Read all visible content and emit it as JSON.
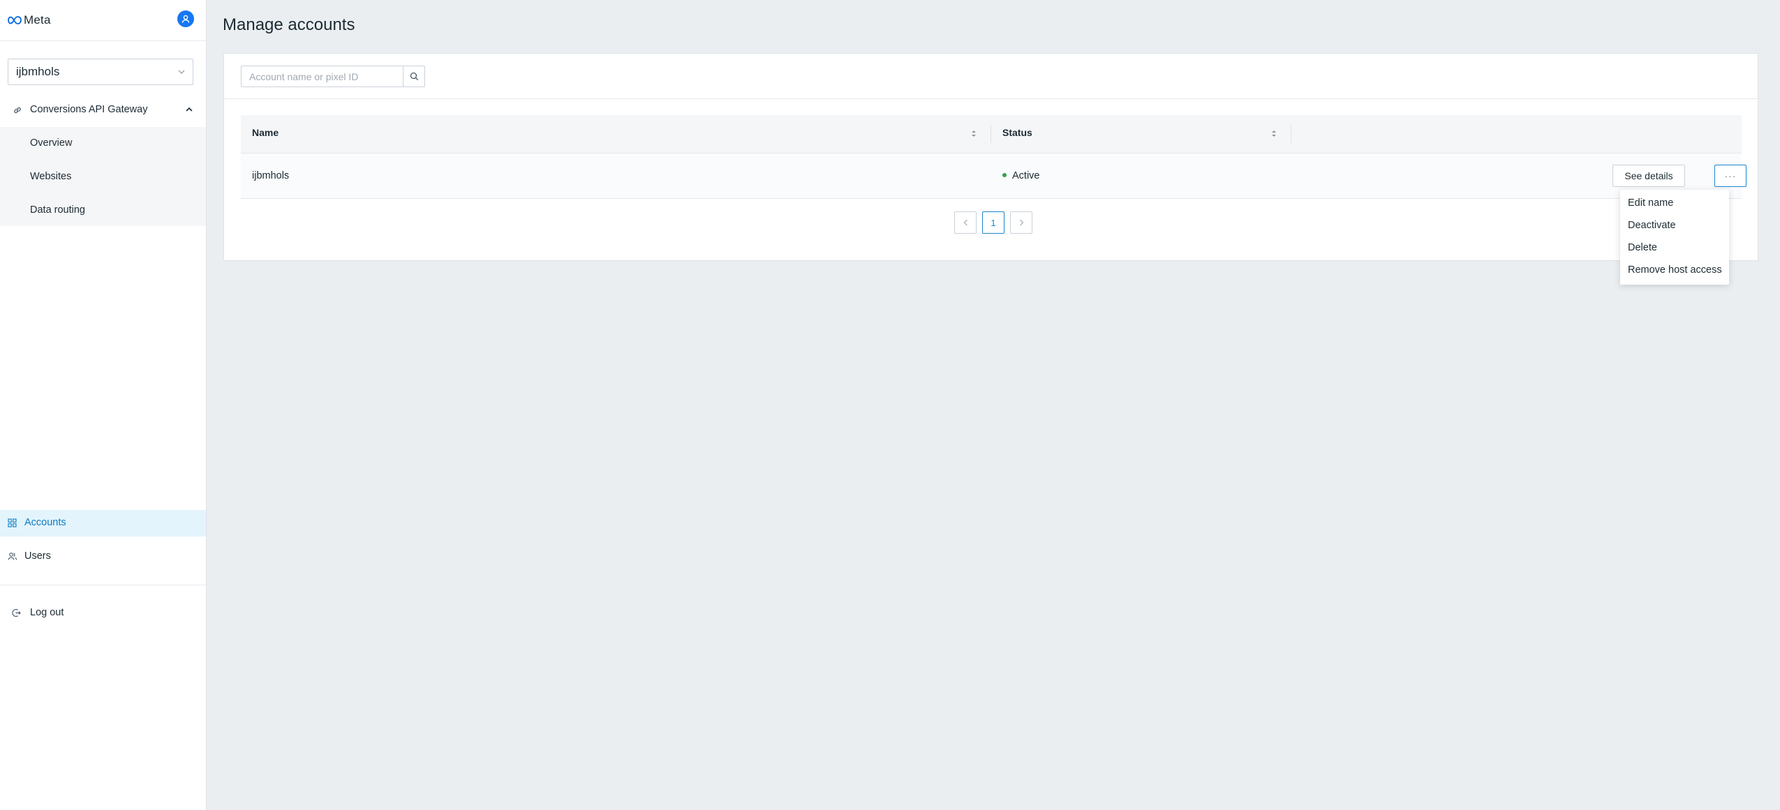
{
  "brand": {
    "name": "Meta"
  },
  "sidebar": {
    "account_selected": "ijbmhols",
    "group": {
      "label": "Conversions API Gateway"
    },
    "subitems": [
      {
        "label": "Overview"
      },
      {
        "label": "Websites"
      },
      {
        "label": "Data routing"
      }
    ],
    "nav": [
      {
        "label": "Accounts",
        "active": true
      },
      {
        "label": "Users",
        "active": false
      }
    ],
    "logout_label": "Log out"
  },
  "main": {
    "title": "Manage accounts",
    "search": {
      "placeholder": "Account name or pixel ID",
      "value": ""
    },
    "table": {
      "columns": [
        "Name",
        "Status"
      ],
      "rows": [
        {
          "name": "ijbmhols",
          "status": "Active",
          "details_label": "See details",
          "more_label": "···"
        }
      ]
    },
    "pagination": {
      "current_page": "1"
    }
  },
  "row_menu": {
    "items": [
      "Edit name",
      "Deactivate",
      "Delete",
      "Remove host access"
    ]
  },
  "colors": {
    "accent": "#1a86d0",
    "active_nav_bg": "#e3f4fd",
    "status_active": "#31a24c",
    "brand_badge": "#1877f2"
  }
}
